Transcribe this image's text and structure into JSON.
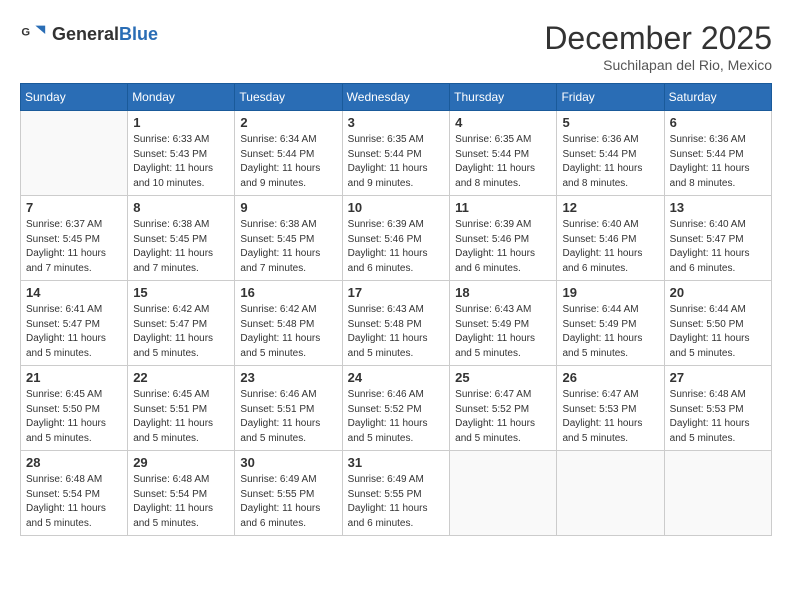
{
  "header": {
    "logo_general": "General",
    "logo_blue": "Blue",
    "month_title": "December 2025",
    "location": "Suchilapan del Rio, Mexico"
  },
  "days_of_week": [
    "Sunday",
    "Monday",
    "Tuesday",
    "Wednesday",
    "Thursday",
    "Friday",
    "Saturday"
  ],
  "weeks": [
    [
      {
        "day": "",
        "info": ""
      },
      {
        "day": "1",
        "info": "Sunrise: 6:33 AM\nSunset: 5:43 PM\nDaylight: 11 hours\nand 10 minutes."
      },
      {
        "day": "2",
        "info": "Sunrise: 6:34 AM\nSunset: 5:44 PM\nDaylight: 11 hours\nand 9 minutes."
      },
      {
        "day": "3",
        "info": "Sunrise: 6:35 AM\nSunset: 5:44 PM\nDaylight: 11 hours\nand 9 minutes."
      },
      {
        "day": "4",
        "info": "Sunrise: 6:35 AM\nSunset: 5:44 PM\nDaylight: 11 hours\nand 8 minutes."
      },
      {
        "day": "5",
        "info": "Sunrise: 6:36 AM\nSunset: 5:44 PM\nDaylight: 11 hours\nand 8 minutes."
      },
      {
        "day": "6",
        "info": "Sunrise: 6:36 AM\nSunset: 5:44 PM\nDaylight: 11 hours\nand 8 minutes."
      }
    ],
    [
      {
        "day": "7",
        "info": "Sunrise: 6:37 AM\nSunset: 5:45 PM\nDaylight: 11 hours\nand 7 minutes."
      },
      {
        "day": "8",
        "info": "Sunrise: 6:38 AM\nSunset: 5:45 PM\nDaylight: 11 hours\nand 7 minutes."
      },
      {
        "day": "9",
        "info": "Sunrise: 6:38 AM\nSunset: 5:45 PM\nDaylight: 11 hours\nand 7 minutes."
      },
      {
        "day": "10",
        "info": "Sunrise: 6:39 AM\nSunset: 5:46 PM\nDaylight: 11 hours\nand 6 minutes."
      },
      {
        "day": "11",
        "info": "Sunrise: 6:39 AM\nSunset: 5:46 PM\nDaylight: 11 hours\nand 6 minutes."
      },
      {
        "day": "12",
        "info": "Sunrise: 6:40 AM\nSunset: 5:46 PM\nDaylight: 11 hours\nand 6 minutes."
      },
      {
        "day": "13",
        "info": "Sunrise: 6:40 AM\nSunset: 5:47 PM\nDaylight: 11 hours\nand 6 minutes."
      }
    ],
    [
      {
        "day": "14",
        "info": "Sunrise: 6:41 AM\nSunset: 5:47 PM\nDaylight: 11 hours\nand 5 minutes."
      },
      {
        "day": "15",
        "info": "Sunrise: 6:42 AM\nSunset: 5:47 PM\nDaylight: 11 hours\nand 5 minutes."
      },
      {
        "day": "16",
        "info": "Sunrise: 6:42 AM\nSunset: 5:48 PM\nDaylight: 11 hours\nand 5 minutes."
      },
      {
        "day": "17",
        "info": "Sunrise: 6:43 AM\nSunset: 5:48 PM\nDaylight: 11 hours\nand 5 minutes."
      },
      {
        "day": "18",
        "info": "Sunrise: 6:43 AM\nSunset: 5:49 PM\nDaylight: 11 hours\nand 5 minutes."
      },
      {
        "day": "19",
        "info": "Sunrise: 6:44 AM\nSunset: 5:49 PM\nDaylight: 11 hours\nand 5 minutes."
      },
      {
        "day": "20",
        "info": "Sunrise: 6:44 AM\nSunset: 5:50 PM\nDaylight: 11 hours\nand 5 minutes."
      }
    ],
    [
      {
        "day": "21",
        "info": "Sunrise: 6:45 AM\nSunset: 5:50 PM\nDaylight: 11 hours\nand 5 minutes."
      },
      {
        "day": "22",
        "info": "Sunrise: 6:45 AM\nSunset: 5:51 PM\nDaylight: 11 hours\nand 5 minutes."
      },
      {
        "day": "23",
        "info": "Sunrise: 6:46 AM\nSunset: 5:51 PM\nDaylight: 11 hours\nand 5 minutes."
      },
      {
        "day": "24",
        "info": "Sunrise: 6:46 AM\nSunset: 5:52 PM\nDaylight: 11 hours\nand 5 minutes."
      },
      {
        "day": "25",
        "info": "Sunrise: 6:47 AM\nSunset: 5:52 PM\nDaylight: 11 hours\nand 5 minutes."
      },
      {
        "day": "26",
        "info": "Sunrise: 6:47 AM\nSunset: 5:53 PM\nDaylight: 11 hours\nand 5 minutes."
      },
      {
        "day": "27",
        "info": "Sunrise: 6:48 AM\nSunset: 5:53 PM\nDaylight: 11 hours\nand 5 minutes."
      }
    ],
    [
      {
        "day": "28",
        "info": "Sunrise: 6:48 AM\nSunset: 5:54 PM\nDaylight: 11 hours\nand 5 minutes."
      },
      {
        "day": "29",
        "info": "Sunrise: 6:48 AM\nSunset: 5:54 PM\nDaylight: 11 hours\nand 5 minutes."
      },
      {
        "day": "30",
        "info": "Sunrise: 6:49 AM\nSunset: 5:55 PM\nDaylight: 11 hours\nand 6 minutes."
      },
      {
        "day": "31",
        "info": "Sunrise: 6:49 AM\nSunset: 5:55 PM\nDaylight: 11 hours\nand 6 minutes."
      },
      {
        "day": "",
        "info": ""
      },
      {
        "day": "",
        "info": ""
      },
      {
        "day": "",
        "info": ""
      }
    ]
  ]
}
